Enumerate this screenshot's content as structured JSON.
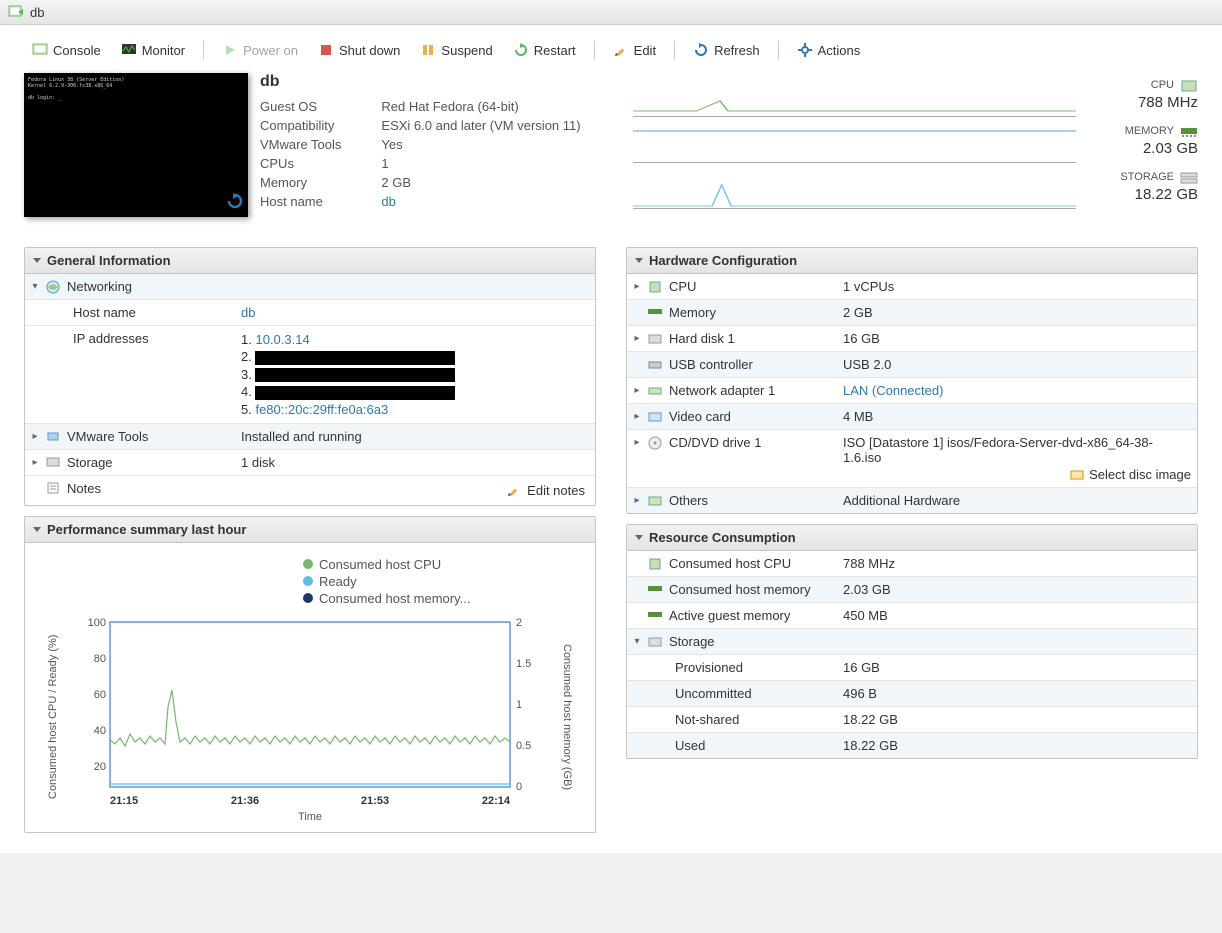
{
  "window": {
    "title": "db"
  },
  "toolbar": {
    "console": "Console",
    "monitor": "Monitor",
    "power_on": "Power on",
    "shut_down": "Shut down",
    "suspend": "Suspend",
    "restart": "Restart",
    "edit": "Edit",
    "refresh": "Refresh",
    "actions": "Actions"
  },
  "vm": {
    "name": "db",
    "guest_os_label": "Guest OS",
    "guest_os": "Red Hat Fedora (64-bit)",
    "compat_label": "Compatibility",
    "compat": "ESXi 6.0 and later (VM version 11)",
    "tools_label": "VMware Tools",
    "tools": "Yes",
    "cpus_label": "CPUs",
    "cpus": "1",
    "memory_label": "Memory",
    "memory": "2 GB",
    "hostname_label": "Host name",
    "hostname": "db"
  },
  "stats": {
    "cpu_label": "CPU",
    "cpu": "788 MHz",
    "mem_label": "MEMORY",
    "mem": "2.03 GB",
    "storage_label": "STORAGE",
    "storage": "18.22 GB"
  },
  "general": {
    "title": "General Information",
    "networking": "Networking",
    "hostname_label": "Host name",
    "hostname": "db",
    "ip_label": "IP addresses",
    "ips": [
      "10.0.3.14",
      "",
      "",
      "",
      "fe80::20c:29ff:fe0a:6a3"
    ],
    "vmware_tools_label": "VMware Tools",
    "vmware_tools": "Installed and running",
    "storage_label": "Storage",
    "storage": "1 disk",
    "notes_label": "Notes",
    "edit_notes": "Edit notes"
  },
  "hw": {
    "title": "Hardware Configuration",
    "cpu_label": "CPU",
    "cpu": "1 vCPUs",
    "mem_label": "Memory",
    "mem": "2 GB",
    "hd_label": "Hard disk 1",
    "hd": "16 GB",
    "usb_label": "USB controller",
    "usb": "USB 2.0",
    "net_label": "Network adapter 1",
    "net": "LAN (Connected)",
    "video_label": "Video card",
    "video": "4 MB",
    "cd_label": "CD/DVD drive 1",
    "cd": "ISO [Datastore 1] isos/Fedora-Server-dvd-x86_64-38-1.6.iso",
    "select_disc": "Select disc image",
    "others_label": "Others",
    "others": "Additional Hardware"
  },
  "res": {
    "title": "Resource Consumption",
    "cpu_label": "Consumed host CPU",
    "cpu": "788 MHz",
    "hmem_label": "Consumed host memory",
    "hmem": "2.03 GB",
    "gmem_label": "Active guest memory",
    "gmem": "450 MB",
    "storage_label": "Storage",
    "prov_label": "Provisioned",
    "prov": "16 GB",
    "uncom_label": "Uncommitted",
    "uncom": "496 B",
    "nshared_label": "Not-shared",
    "nshared": "18.22 GB",
    "used_label": "Used",
    "used": "18.22 GB"
  },
  "perf": {
    "title": "Performance summary last hour",
    "legend_cpu": "Consumed host CPU",
    "legend_ready": "Ready",
    "legend_mem": "Consumed host memory...",
    "y_left": "Consumed host CPU / Ready (%)",
    "y_right": "Consumed host memory (GB)",
    "x_label": "Time",
    "x_ticks": [
      "21:15",
      "21:36",
      "21:53",
      "22:14"
    ],
    "y_left_ticks": [
      "100",
      "80",
      "60",
      "40",
      "20"
    ],
    "y_right_ticks": [
      "2",
      "1.5",
      "1",
      "0.5",
      "0"
    ]
  },
  "chart_data": {
    "type": "line",
    "x_range": [
      "21:15",
      "22:14"
    ],
    "y_left_range": [
      0,
      100
    ],
    "y_right_range": [
      0,
      2
    ],
    "series": [
      {
        "name": "Consumed host CPU",
        "axis": "left",
        "unit": "%",
        "approx_trend": "~28% steady with spike to ~55% near 21:26"
      },
      {
        "name": "Ready",
        "axis": "left",
        "unit": "%",
        "approx_trend": "~2-3% flat"
      },
      {
        "name": "Consumed host memory",
        "axis": "right",
        "unit": "GB",
        "approx_trend": "near 0 (line along x-axis)"
      }
    ],
    "title": "Performance summary last hour",
    "xlabel": "Time",
    "ylabel_left": "Consumed host CPU / Ready (%)",
    "ylabel_right": "Consumed host memory (GB)"
  }
}
